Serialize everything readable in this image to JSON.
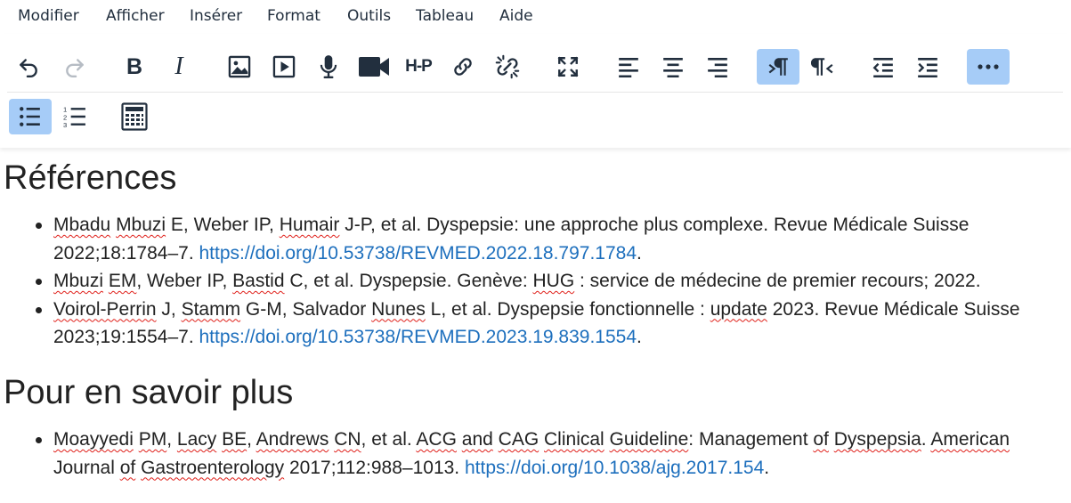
{
  "menu": [
    "Modifier",
    "Afficher",
    "Insérer",
    "Format",
    "Outils",
    "Tableau",
    "Aide"
  ],
  "toolbar": {
    "row1": [
      {
        "name": "undo-icon",
        "active": false
      },
      {
        "name": "redo-icon",
        "active": false
      },
      {
        "name": "bold-icon",
        "active": false
      },
      {
        "name": "italic-icon",
        "active": false
      },
      {
        "name": "image-icon",
        "active": false
      },
      {
        "name": "media-icon",
        "active": false
      },
      {
        "name": "microphone-icon",
        "active": false
      },
      {
        "name": "video-camera-icon",
        "active": false
      },
      {
        "name": "h5p-icon",
        "active": false
      },
      {
        "name": "link-icon",
        "active": false
      },
      {
        "name": "unlink-icon",
        "active": false
      },
      {
        "name": "fullscreen-icon",
        "active": false
      },
      {
        "name": "align-left-icon",
        "active": false
      },
      {
        "name": "align-center-icon",
        "active": false
      },
      {
        "name": "align-right-icon",
        "active": false
      },
      {
        "name": "ltr-icon",
        "active": true
      },
      {
        "name": "rtl-icon",
        "active": false
      },
      {
        "name": "outdent-icon",
        "active": false
      },
      {
        "name": "indent-icon",
        "active": false
      },
      {
        "name": "more-icon",
        "active": true
      }
    ],
    "row2": [
      {
        "name": "bullet-list-icon",
        "active": true
      },
      {
        "name": "numbered-list-icon",
        "active": false
      },
      {
        "name": "calculator-icon",
        "active": false
      }
    ],
    "h5p_text": "H-P",
    "italic_text": "I",
    "bold_text": "B"
  },
  "sections": [
    {
      "title": "Références",
      "items": [
        [
          {
            "t": "Mbadu",
            "s": true
          },
          {
            "t": " "
          },
          {
            "t": "Mbuzi",
            "s": true
          },
          {
            "t": " E, Weber IP, "
          },
          {
            "t": "Humair",
            "s": true
          },
          {
            "t": " J-P, et al. Dyspepsie: une approche plus complexe. Revue Médicale Suisse 2022;18:1784–7. "
          },
          {
            "t": "https://doi.org/10.53738/REVMED.2022.18.797.1784",
            "l": true
          },
          {
            "t": "."
          }
        ],
        [
          {
            "t": "Mbuzi",
            "s": true
          },
          {
            "t": " "
          },
          {
            "t": "EM",
            "s": true
          },
          {
            "t": ", Weber IP, "
          },
          {
            "t": "Bastid",
            "s": true
          },
          {
            "t": " C, et al. Dyspepsie. Genève: "
          },
          {
            "t": "HUG",
            "s": true
          },
          {
            "t": " : service de médecine de premier recours; 2022."
          }
        ],
        [
          {
            "t": "Voirol-Perrin",
            "s": true
          },
          {
            "t": " J, "
          },
          {
            "t": "Stamm",
            "s": true
          },
          {
            "t": " G-M, Salvador "
          },
          {
            "t": "Nunes",
            "s": true
          },
          {
            "t": " L, et al. Dyspepsie fonctionnelle : "
          },
          {
            "t": "update",
            "s": true
          },
          {
            "t": " 2023. Revue Médicale Suisse 2023;19:1554–7. "
          },
          {
            "t": "https://doi.org/10.53738/REVMED.2023.19.839.1554",
            "l": true
          },
          {
            "t": "."
          }
        ]
      ]
    },
    {
      "title": "Pour en savoir plus",
      "items": [
        [
          {
            "t": "Moayyedi",
            "s": true
          },
          {
            "t": " "
          },
          {
            "t": "PM",
            "s": true
          },
          {
            "t": ", "
          },
          {
            "t": "Lacy",
            "s": true
          },
          {
            "t": " "
          },
          {
            "t": "BE",
            "s": true
          },
          {
            "t": ", "
          },
          {
            "t": "Andrews",
            "s": true
          },
          {
            "t": " "
          },
          {
            "t": "CN",
            "s": true
          },
          {
            "t": ", et al. "
          },
          {
            "t": "ACG",
            "s": true
          },
          {
            "t": " "
          },
          {
            "t": "and",
            "s": true
          },
          {
            "t": " "
          },
          {
            "t": "CAG",
            "s": true
          },
          {
            "t": " "
          },
          {
            "t": "Clinical",
            "s": true
          },
          {
            "t": " "
          },
          {
            "t": "Guideline",
            "s": true
          },
          {
            "t": ": Management "
          },
          {
            "t": "of",
            "s": true
          },
          {
            "t": " "
          },
          {
            "t": "Dyspepsia",
            "s": true
          },
          {
            "t": ". "
          },
          {
            "t": "American",
            "s": true
          },
          {
            "t": " Journal "
          },
          {
            "t": "of",
            "s": true
          },
          {
            "t": " "
          },
          {
            "t": "Gastroenterology",
            "s": true
          },
          {
            "t": " 2017;112:988–1013. "
          },
          {
            "t": "https://doi.org/10.1038/ajg.2017.154",
            "l": true
          },
          {
            "t": "."
          }
        ]
      ]
    }
  ]
}
